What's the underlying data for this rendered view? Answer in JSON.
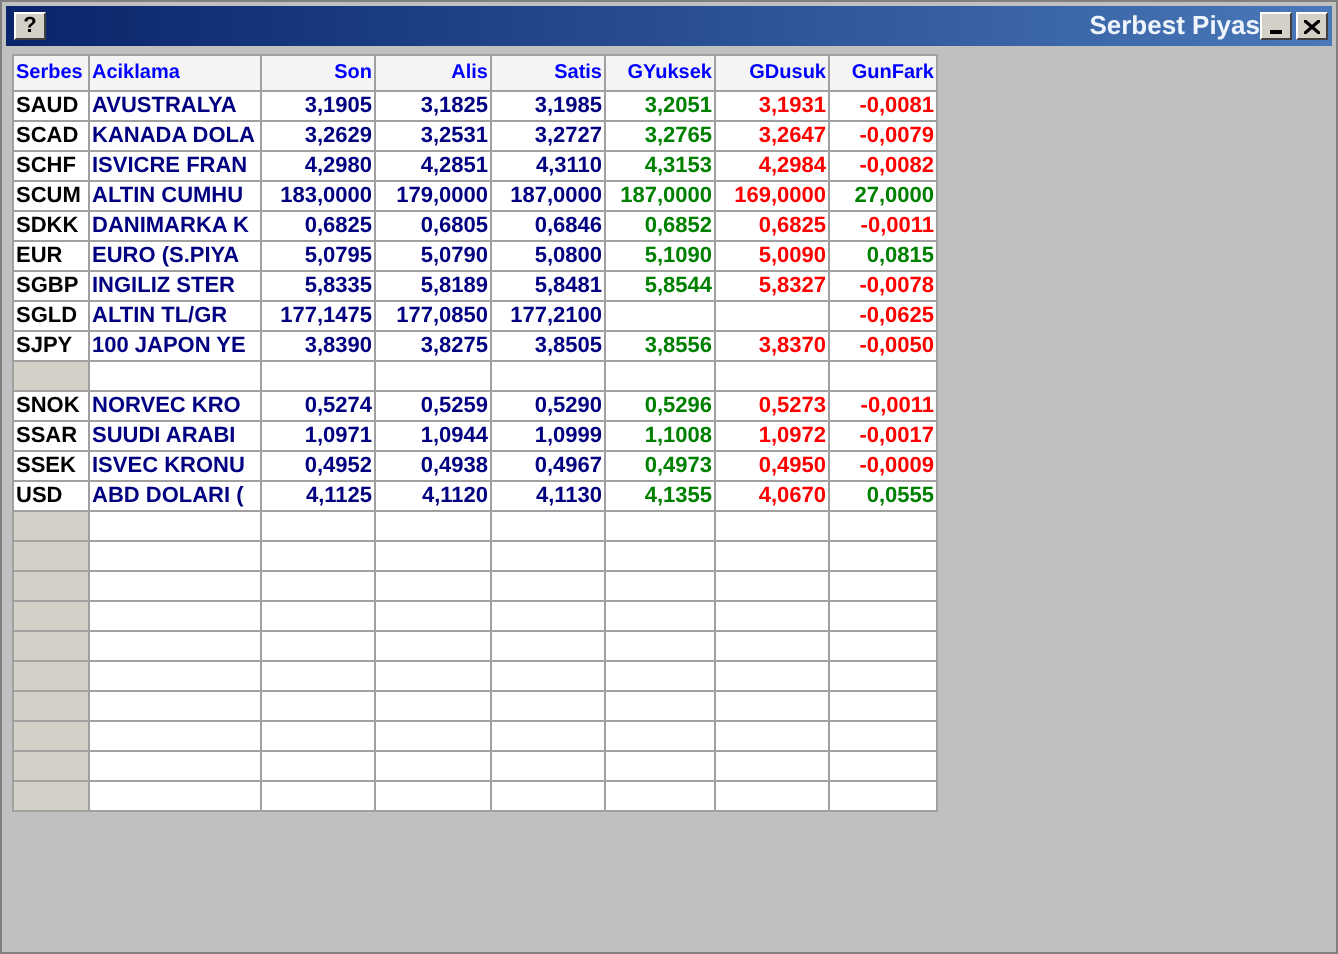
{
  "window": {
    "title": "Serbest Piyas",
    "help_button": "?"
  },
  "table": {
    "columns": [
      {
        "label": "Serbes"
      },
      {
        "label": "Aciklama"
      },
      {
        "label": "Son"
      },
      {
        "label": "Alis"
      },
      {
        "label": "Satis"
      },
      {
        "label": "GYuksek"
      },
      {
        "label": "GDusuk"
      },
      {
        "label": "GunFark"
      }
    ],
    "rows": [
      {
        "kind": "data",
        "code": "SAUD",
        "name": "AVUSTRALYA",
        "son": "3,1905",
        "alis": "3,1825",
        "satis": "3,1985",
        "gyuksek": "3,2051",
        "gdusuk": "3,1931",
        "gunfark": "-0,0081",
        "color": "#ff0000"
      },
      {
        "kind": "data",
        "code": "SCAD",
        "name": "KANADA DOLA",
        "son": "3,2629",
        "alis": "3,2531",
        "satis": "3,2727",
        "gyuksek": "3,2765",
        "gdusuk": "3,2647",
        "gunfark": "-0,0079",
        "color": "#ff0000"
      },
      {
        "kind": "data",
        "code": "SCHF",
        "name": "ISVICRE FRAN",
        "son": "4,2980",
        "alis": "4,2851",
        "satis": "4,3110",
        "gyuksek": "4,3153",
        "gdusuk": "4,2984",
        "gunfark": "-0,0082",
        "color": "#ff0000"
      },
      {
        "kind": "data",
        "code": "SCUM",
        "name": "ALTIN CUMHU",
        "son": "183,0000",
        "alis": "179,0000",
        "satis": "187,0000",
        "gyuksek": "187,0000",
        "gdusuk": "169,0000",
        "gunfark": "27,0000",
        "color": "#008000"
      },
      {
        "kind": "data",
        "code": "SDKK",
        "name": "DANIMARKA K",
        "son": "0,6825",
        "alis": "0,6805",
        "satis": "0,6846",
        "gyuksek": "0,6852",
        "gdusuk": "0,6825",
        "gunfark": "-0,0011",
        "color": "#ff0000"
      },
      {
        "kind": "data",
        "code": "EUR",
        "name": "EURO (S.PIYA",
        "son": "5,0795",
        "alis": "5,0790",
        "satis": "5,0800",
        "gyuksek": "5,1090",
        "gdusuk": "5,0090",
        "gunfark": "0,0815",
        "color": "#008000"
      },
      {
        "kind": "data",
        "code": "SGBP",
        "name": "INGILIZ STER",
        "son": "5,8335",
        "alis": "5,8189",
        "satis": "5,8481",
        "gyuksek": "5,8544",
        "gdusuk": "5,8327",
        "gunfark": "-0,0078",
        "color": "#ff0000"
      },
      {
        "kind": "data",
        "code": "SGLD",
        "name": "ALTIN TL/GR",
        "son": "177,1475",
        "alis": "177,0850",
        "satis": "177,2100",
        "gunfark": "-0,0625",
        "color": "#ff0000"
      },
      {
        "kind": "data",
        "code": "SJPY",
        "name": "100 JAPON YE",
        "son": "3,8390",
        "alis": "3,8275",
        "satis": "3,8505",
        "gyuksek": "3,8556",
        "gdusuk": "3,8370",
        "gunfark": "-0,0050",
        "color": "#ff0000"
      },
      {
        "kind": "blank"
      },
      {
        "kind": "data",
        "code": "SNOK",
        "name": "NORVEC KRO",
        "son": "0,5274",
        "alis": "0,5259",
        "satis": "0,5290",
        "gyuksek": "0,5296",
        "gdusuk": "0,5273",
        "gunfark": "-0,0011",
        "color": "#ff0000"
      },
      {
        "kind": "data",
        "code": "SSAR",
        "name": "SUUDI ARABI",
        "son": "1,0971",
        "alis": "1,0944",
        "satis": "1,0999",
        "gyuksek": "1,1008",
        "gdusuk": "1,0972",
        "gunfark": "-0,0017",
        "color": "#ff0000"
      },
      {
        "kind": "data",
        "code": "SSEK",
        "name": "ISVEC KRONU",
        "son": "0,4952",
        "alis": "0,4938",
        "satis": "0,4967",
        "gyuksek": "0,4973",
        "gdusuk": "0,4950",
        "gunfark": "-0,0009",
        "color": "#ff0000"
      },
      {
        "kind": "data",
        "code": "USD",
        "name": "ABD DOLARI (",
        "son": "4,1125",
        "alis": "4,1120",
        "satis": "4,1130",
        "gyuksek": "4,1355",
        "gdusuk": "4,0670",
        "gunfark": "0,0555",
        "color": "#008000"
      }
    ]
  }
}
